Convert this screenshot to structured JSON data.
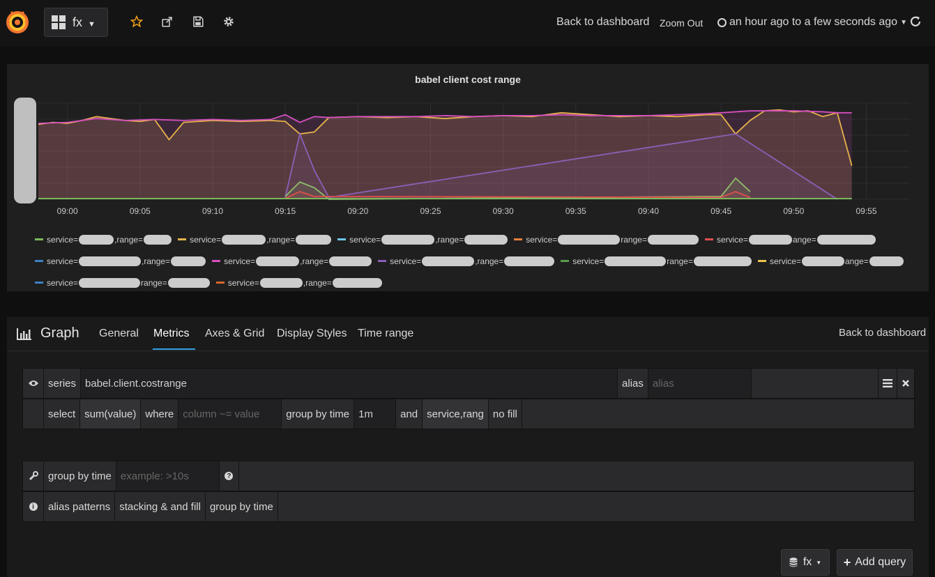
{
  "topbar": {
    "dashboard_name": "fx",
    "back_to_dashboard": "Back to dashboard",
    "zoom_out": "Zoom Out",
    "time_range": "an hour ago to a few seconds ago"
  },
  "chart_data": {
    "type": "line",
    "title": "babel client cost range",
    "x_ticks": [
      "09:00",
      "09:05",
      "09:10",
      "09:15",
      "09:20",
      "09:25",
      "09:30",
      "09:35",
      "09:40",
      "09:45",
      "09:50",
      "09:55"
    ],
    "grid": true,
    "legend_position": "bottom",
    "series": [
      {
        "color": "#e8b24a",
        "x": [
          "08:58",
          "08:59",
          "09:00",
          "09:01",
          "09:02",
          "09:03",
          "09:04",
          "09:05",
          "09:06",
          "09:07",
          "09:08",
          "09:10",
          "09:12",
          "09:14",
          "09:15",
          "09:16",
          "09:17",
          "09:18",
          "09:20",
          "09:22",
          "09:24",
          "09:26",
          "09:28",
          "09:30",
          "09:32",
          "09:34",
          "09:36",
          "09:38",
          "09:40",
          "09:42",
          "09:44",
          "09:45",
          "09:46",
          "09:47",
          "09:48",
          "09:49",
          "09:50",
          "09:51",
          "09:52",
          "09:53",
          "09:54"
        ],
        "y": [
          0.78,
          0.8,
          0.79,
          0.82,
          0.86,
          0.84,
          0.82,
          0.81,
          0.83,
          0.62,
          0.8,
          0.82,
          0.81,
          0.82,
          0.81,
          0.68,
          0.7,
          0.85,
          0.86,
          0.85,
          0.86,
          0.84,
          0.86,
          0.87,
          0.86,
          0.9,
          0.88,
          0.86,
          0.87,
          0.86,
          0.88,
          0.88,
          0.68,
          0.82,
          0.92,
          0.93,
          0.91,
          0.92,
          0.86,
          0.9,
          0.35
        ]
      },
      {
        "color": "#d44fbf",
        "x": [
          "08:58",
          "09:00",
          "09:02",
          "09:04",
          "09:06",
          "09:08",
          "09:10",
          "09:12",
          "09:14",
          "09:15",
          "09:16",
          "09:17",
          "09:18",
          "09:20",
          "09:22",
          "09:24",
          "09:26",
          "09:28",
          "09:30",
          "09:32",
          "09:34",
          "09:36",
          "09:38",
          "09:40",
          "09:42",
          "09:44",
          "09:45",
          "09:46",
          "09:47",
          "09:48",
          "09:50",
          "09:52",
          "09:53",
          "09:54"
        ],
        "y": [
          0.79,
          0.8,
          0.84,
          0.82,
          0.83,
          0.82,
          0.83,
          0.82,
          0.83,
          0.88,
          0.8,
          0.86,
          0.85,
          0.86,
          0.86,
          0.86,
          0.87,
          0.86,
          0.87,
          0.87,
          0.88,
          0.87,
          0.87,
          0.87,
          0.88,
          0.89,
          0.9,
          0.91,
          0.92,
          0.92,
          0.92,
          0.91,
          0.9,
          0.9
        ]
      },
      {
        "color": "#8b5fb8",
        "x": [
          "09:15",
          "09:16",
          "09:17",
          "09:18",
          "09:46",
          "09:53"
        ],
        "y": [
          0.02,
          0.68,
          0.3,
          0.02,
          0.68,
          0.0
        ]
      },
      {
        "color": "#8fbf6a",
        "x": [
          "09:15",
          "09:16",
          "09:17",
          "09:18",
          "09:45",
          "09:46",
          "09:47"
        ],
        "y": [
          0.03,
          0.18,
          0.12,
          0.0,
          0.03,
          0.22,
          0.08
        ]
      },
      {
        "color": "#e04e4e",
        "x": [
          "09:15",
          "09:16",
          "09:17",
          "09:45",
          "09:46",
          "09:47"
        ],
        "y": [
          0.01,
          0.08,
          0.03,
          0.02,
          0.08,
          0.02
        ]
      }
    ]
  },
  "legend_rows": [
    [
      {
        "color": "#7db85d",
        "a": "service=",
        "b": ",range="
      },
      {
        "color": "#e8b24a",
        "a": "service=",
        "b": ",range="
      },
      {
        "color": "#6ec6e8",
        "a": "service=",
        "b": ",range="
      },
      {
        "color": "#e67e3c",
        "a": "service=",
        "b": "range="
      },
      {
        "color": "#e04e4e",
        "a": "service=",
        "b": "ange="
      }
    ],
    [
      {
        "color": "#3d82c4",
        "a": "service=",
        "b": ",range="
      },
      {
        "color": "#d44fbf",
        "a": "service=",
        "b": ",range="
      },
      {
        "color": "#8b5fb8",
        "a": "service=",
        "b": ",range="
      },
      {
        "color": "#5c9c4a",
        "a": "service=",
        "b": "range="
      },
      {
        "color": "#e8c44a",
        "a": "service=",
        "b": "ange="
      }
    ],
    [
      {
        "color": "#3d82c4",
        "a": "service=",
        "b": "range="
      },
      {
        "color": "#d8662a",
        "a": "service=",
        "b": ",range="
      }
    ]
  ],
  "editor": {
    "panel_type": "Graph",
    "tabs": [
      "General",
      "Metrics",
      "Axes & Grid",
      "Display Styles",
      "Time range"
    ],
    "back_to_dashboard": "Back to dashboard",
    "query": {
      "series_label": "series",
      "series_value": "babel.client.costrange",
      "alias_label": "alias",
      "alias_placeholder": "alias",
      "select_label": "select",
      "select_value": "sum(value)",
      "where_label": "where",
      "where_placeholder": "column ~= value",
      "group_by_time_label": "group by time",
      "group_by_time_value": "1m",
      "and_label": "and",
      "and_value": "service,rang",
      "fill_value": "no fill"
    },
    "options": {
      "group_by_time_label": "group by time",
      "group_by_time_placeholder": "example: >10s",
      "help_links": [
        "alias patterns",
        "stacking & and fill",
        "group by time"
      ]
    },
    "datasource": "fx",
    "add_query": "Add query"
  }
}
